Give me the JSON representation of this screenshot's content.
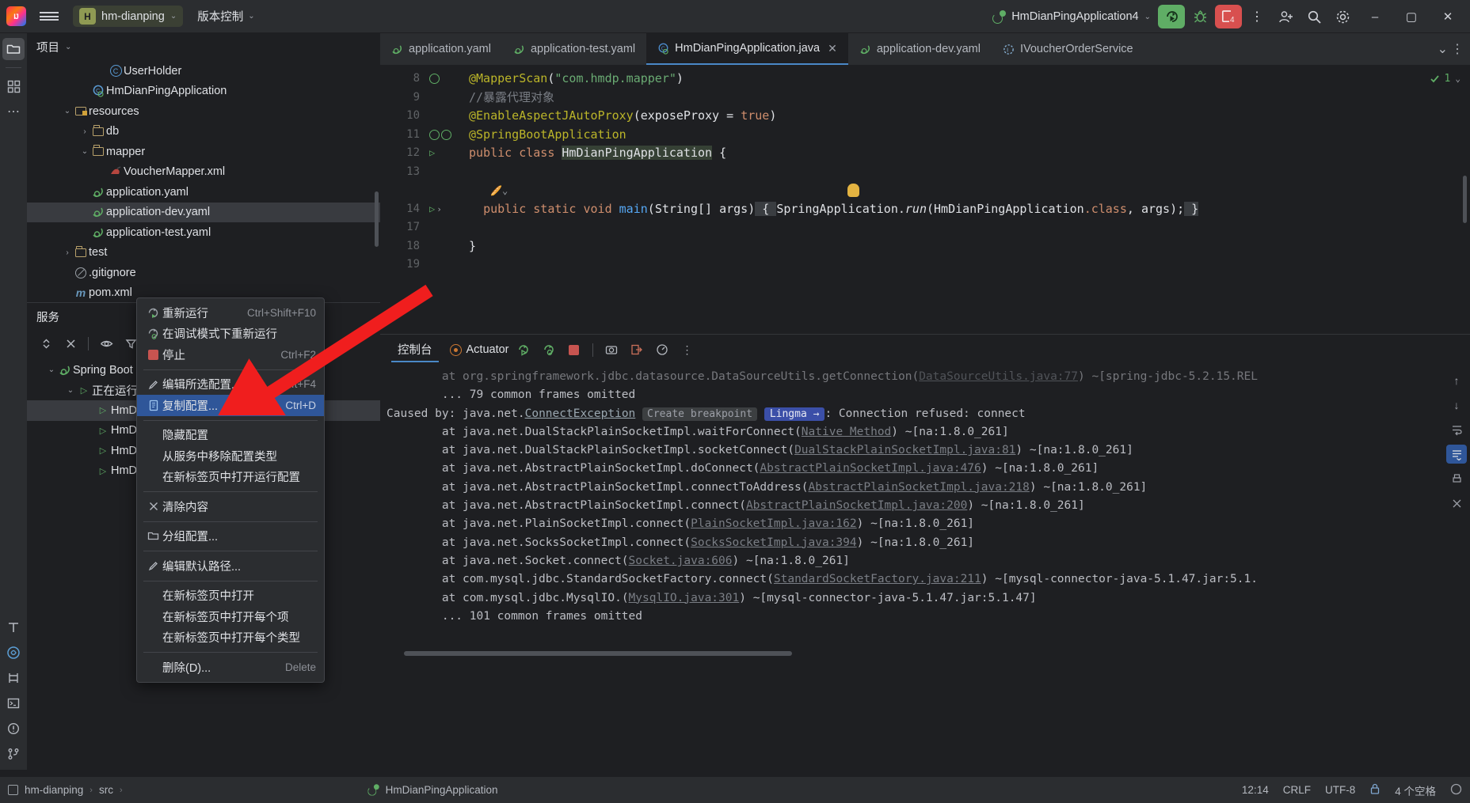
{
  "titlebar": {
    "logo": "ij-logo-icon",
    "menu_icon": "hamburger-menu-icon",
    "project_badge": "H",
    "project_name": "hm-dianping",
    "vcs_label": "版本控制",
    "run_config": "HmDianPingApplication4",
    "run_button": "run-icon",
    "debug_button": "debug-icon",
    "stop_badge": "4",
    "more_button": "⋮",
    "add_user": "add-user-icon",
    "search": "search-icon",
    "settings": "settings-icon",
    "minimize": "–",
    "maximize": "▢",
    "close": "✕"
  },
  "project_panel": {
    "title": "项目",
    "tree": [
      {
        "indent": 4,
        "arrow": "",
        "icon": "class-icon",
        "label": "UserHolder",
        "selected": false
      },
      {
        "indent": 3,
        "arrow": "",
        "icon": "spring-class-icon",
        "label": "HmDianPingApplication",
        "selected": false
      },
      {
        "indent": 2,
        "arrow": "v",
        "icon": "resources-folder-icon",
        "label": "resources",
        "selected": false
      },
      {
        "indent": 3,
        "arrow": ">",
        "icon": "folder-icon",
        "label": "db",
        "selected": false
      },
      {
        "indent": 3,
        "arrow": "v",
        "icon": "folder-icon",
        "label": "mapper",
        "selected": false
      },
      {
        "indent": 4,
        "arrow": "",
        "icon": "xml-icon",
        "label": "VoucherMapper.xml",
        "selected": false
      },
      {
        "indent": 3,
        "arrow": "",
        "icon": "spring-yaml-icon",
        "label": "application.yaml",
        "selected": false
      },
      {
        "indent": 3,
        "arrow": "",
        "icon": "spring-yaml-icon",
        "label": "application-dev.yaml",
        "selected": true
      },
      {
        "indent": 3,
        "arrow": "",
        "icon": "spring-yaml-icon",
        "label": "application-test.yaml",
        "selected": false
      },
      {
        "indent": 2,
        "arrow": ">",
        "icon": "folder-icon",
        "label": "test",
        "selected": false
      },
      {
        "indent": 2,
        "arrow": "",
        "icon": "gitignore-icon",
        "label": ".gitignore",
        "selected": false
      },
      {
        "indent": 2,
        "arrow": "",
        "icon": "maven-icon",
        "label": "pom.xml",
        "selected": false
      }
    ]
  },
  "services_panel": {
    "title": "服务",
    "toolbar": [
      "expand-collapse-icon",
      "close-all-icon",
      "eye-icon",
      "filter-icon",
      "layout-icon"
    ],
    "tree": [
      {
        "indent": 1,
        "arrow": "v",
        "icon": "spring-boot-icon",
        "label": "Spring Boot"
      },
      {
        "indent": 2,
        "arrow": "v",
        "icon": "run-triangle-icon",
        "label": "正在运行"
      },
      {
        "indent": 3,
        "arrow": "",
        "icon": "run-triangle-icon",
        "label": "HmDi"
      },
      {
        "indent": 3,
        "arrow": "",
        "icon": "run-triangle-icon",
        "label": "HmDi"
      },
      {
        "indent": 3,
        "arrow": "",
        "icon": "run-triangle-icon",
        "label": "HmDi"
      },
      {
        "indent": 3,
        "arrow": "",
        "icon": "run-triangle-icon",
        "label": "HmDi"
      }
    ]
  },
  "context_menu": {
    "items": [
      {
        "type": "item",
        "icon": "rerun-icon",
        "label": "重新运行",
        "shortcut": "Ctrl+Shift+F10",
        "highlighted": false
      },
      {
        "type": "item",
        "icon": "rerun-debug-icon",
        "label": "在调试模式下重新运行",
        "shortcut": "",
        "highlighted": false
      },
      {
        "type": "item",
        "icon": "stop-icon",
        "label": "停止",
        "shortcut": "Ctrl+F2",
        "highlighted": false
      },
      {
        "type": "sep"
      },
      {
        "type": "item",
        "icon": "pencil-icon",
        "label": "编辑所选配置...",
        "shortcut": "Shift+F4",
        "highlighted": false
      },
      {
        "type": "item",
        "icon": "copy-config-icon",
        "label": "复制配置...",
        "shortcut": "Ctrl+D",
        "highlighted": true
      },
      {
        "type": "sep"
      },
      {
        "type": "item",
        "icon": "",
        "label": "隐藏配置",
        "shortcut": "",
        "highlighted": false
      },
      {
        "type": "item",
        "icon": "",
        "label": "从服务中移除配置类型",
        "shortcut": "",
        "highlighted": false
      },
      {
        "type": "item",
        "icon": "",
        "label": "在新标签页中打开运行配置",
        "shortcut": "",
        "highlighted": false
      },
      {
        "type": "sep"
      },
      {
        "type": "item",
        "icon": "x-icon",
        "label": "清除内容",
        "shortcut": "",
        "highlighted": false
      },
      {
        "type": "sep"
      },
      {
        "type": "item",
        "icon": "group-icon",
        "label": "分组配置...",
        "shortcut": "",
        "highlighted": false
      },
      {
        "type": "sep"
      },
      {
        "type": "item",
        "icon": "pencil-icon",
        "label": "编辑默认路径...",
        "shortcut": "",
        "highlighted": false
      },
      {
        "type": "sep"
      },
      {
        "type": "item",
        "icon": "",
        "label": "在新标签页中打开",
        "shortcut": "",
        "highlighted": false
      },
      {
        "type": "item",
        "icon": "",
        "label": "在新标签页中打开每个项",
        "shortcut": "",
        "highlighted": false
      },
      {
        "type": "item",
        "icon": "",
        "label": "在新标签页中打开每个类型",
        "shortcut": "",
        "highlighted": false
      },
      {
        "type": "sep"
      },
      {
        "type": "item",
        "icon": "",
        "label": "删除(D)...",
        "shortcut": "Delete",
        "highlighted": false
      }
    ]
  },
  "editor": {
    "tabs": [
      {
        "icon": "spring-yaml-icon",
        "label": "application.yaml",
        "active": false,
        "closable": false
      },
      {
        "icon": "spring-yaml-icon",
        "label": "application-test.yaml",
        "active": false,
        "closable": false
      },
      {
        "icon": "java-class-icon",
        "label": "HmDianPingApplication.java",
        "active": true,
        "closable": true
      },
      {
        "icon": "spring-yaml-icon",
        "label": "application-dev.yaml",
        "active": false,
        "closable": false
      },
      {
        "icon": "java-interface-icon",
        "label": "IVoucherOrderService",
        "active": false,
        "closable": false
      }
    ],
    "tabbar_overflow": "chevron-down-icon",
    "tabbar_more": "⋮",
    "inspection_count": "1",
    "lines": [
      {
        "num": "8",
        "marks": [
          "inspection-icon"
        ]
      },
      {
        "num": "9",
        "marks": []
      },
      {
        "num": "10",
        "marks": []
      },
      {
        "num": "11",
        "marks": [
          "bean-icon",
          "bean-check-icon"
        ]
      },
      {
        "num": "12",
        "marks": [
          "run-gutter-icon"
        ]
      },
      {
        "num": "13",
        "marks": []
      },
      {
        "num": "14",
        "marks": [
          "run-gutter-icon",
          "fold-icon"
        ]
      },
      {
        "num": "17",
        "marks": []
      },
      {
        "num": "18",
        "marks": []
      },
      {
        "num": "19",
        "marks": []
      }
    ],
    "code_text": {
      "l8_ann": "@MapperScan",
      "l8_str": "\"com.hmdp.mapper\"",
      "l9_comment": "//暴露代理对象",
      "l10_ann": "@EnableAspectJAutoProxy",
      "l10_param": "exposeProxy",
      "l10_true": "true",
      "l11_ann": "@SpringBootApplication",
      "l12_kw1": "public",
      "l12_kw2": "class",
      "l12_name": "HmDianPingApplication",
      "l14_kw": "public static void",
      "l14_main": "main",
      "l14_args": "String[] args",
      "l14_body": "SpringApplication.",
      "l14_run": "run",
      "l14_arg1": "HmDianPingApplication",
      "l14_cls": ".class",
      "l14_arg2": "args"
    }
  },
  "console": {
    "tab_label": "控制台",
    "actuator_label": "Actuator",
    "buttons": [
      "rerun-icon",
      "rerun-debug-icon",
      "stop-icon",
      "camera-icon",
      "export-icon",
      "profile-icon",
      "more-icon"
    ],
    "lines": [
      "        at org.springframework.jdbc.datasource.DataSourceUtils.getConnection(DataSourceUtils.java:77) ~[spring-jdbc-5.2.15.REL",
      "        ... 79 common frames omitted",
      "Caused by: java.net.ConnectException : Connection refused: connect",
      "        at java.net.DualStackPlainSocketImpl.waitForConnect(Native Method) ~[na:1.8.0_261]",
      "        at java.net.DualStackPlainSocketImpl.socketConnect(DualStackPlainSocketImpl.java:81) ~[na:1.8.0_261]",
      "        at java.net.AbstractPlainSocketImpl.doConnect(AbstractPlainSocketImpl.java:476) ~[na:1.8.0_261]",
      "        at java.net.AbstractPlainSocketImpl.connectToAddress(AbstractPlainSocketImpl.java:218) ~[na:1.8.0_261]",
      "        at java.net.AbstractPlainSocketImpl.connect(AbstractPlainSocketImpl.java:200) ~[na:1.8.0_261]",
      "        at java.net.PlainSocketImpl.connect(PlainSocketImpl.java:162) ~[na:1.8.0_261]",
      "        at java.net.SocksSocketImpl.connect(SocksSocketImpl.java:394) ~[na:1.8.0_261]",
      "        at java.net.Socket.connect(Socket.java:606) ~[na:1.8.0_261]",
      "        at com.mysql.jdbc.StandardSocketFactory.connect(StandardSocketFactory.java:211) ~[mysql-connector-java-5.1.47.jar:5.1.",
      "        at com.mysql.jdbc.MysqlIO.<init>(MysqlIO.java:301) ~[mysql-connector-java-5.1.47.jar:5.1.47]",
      "        ... 101 common frames omitted"
    ],
    "exception_parts": {
      "prefix": "Caused by: java.net.",
      "exception": "ConnectException",
      "breakpoint_badge": "Create breakpoint",
      "lingma_badge": "Lingma →",
      "suffix": ": Connection refused: connect"
    }
  },
  "statusbar": {
    "project_crumb": "hm-dianping",
    "src_crumb": "src",
    "run_label": "HmDianPingApplication",
    "time": "12:14",
    "line_sep": "CRLF",
    "encoding": "UTF-8",
    "indent": "4 个空格",
    "lock_icon": "lock-icon",
    "ai_icon": "ai-assistant-icon"
  }
}
